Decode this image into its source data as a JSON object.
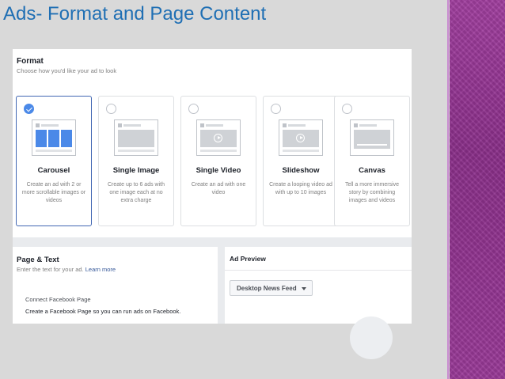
{
  "slide": {
    "title": "Ads- Format and Page Content"
  },
  "format": {
    "title": "Format",
    "subtitle": "Choose how you'd like your ad to look",
    "cards": [
      {
        "title": "Carousel",
        "desc": "Create an ad with 2 or more scrollable images or videos",
        "selected": true
      },
      {
        "title": "Single Image",
        "desc": "Create up to 6 ads with one image each at no extra charge",
        "selected": false
      },
      {
        "title": "Single Video",
        "desc": "Create an ad with one video",
        "selected": false
      },
      {
        "title": "Slideshow",
        "desc": "Create a looping video ad with up to 10 images",
        "selected": false
      },
      {
        "title": "Canvas",
        "desc": "Tell a more immersive story by combining images and videos",
        "selected": false
      }
    ]
  },
  "page_text": {
    "title": "Page & Text",
    "subtitle": "Enter the text for your ad.",
    "learn_more": "Learn more",
    "connect_title": "Connect Facebook Page",
    "connect_desc": "Create a Facebook Page so you can run ads on Facebook."
  },
  "ad_preview": {
    "title": "Ad Preview",
    "placement": "Desktop News Feed"
  },
  "colors": {
    "title": "#1f6fb4",
    "accent": "#4b89e8",
    "deco": "#9a3a98"
  }
}
